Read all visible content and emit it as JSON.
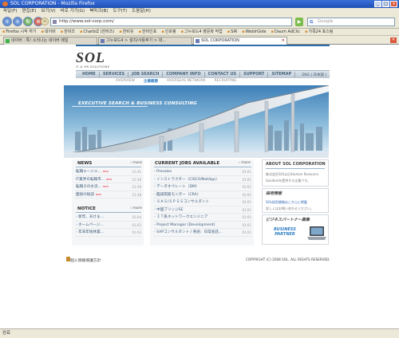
{
  "window": {
    "title": "SOL CORPORATION - Mozilla Firefox",
    "buttons": [
      "_",
      "□",
      "×"
    ]
  },
  "menu": [
    "파일(F)",
    "편집(E)",
    "보기(V)",
    "바로 가기(G)",
    "북마크(B)",
    "도구(T)",
    "도움말(H)"
  ],
  "address": {
    "url": "http://www.sol-corp.com/",
    "search_placeholder": "Google"
  },
  "bookmarks": [
    "Firefox 시작 하기",
    "네이버",
    "한비즈",
    "CharbiZ (한비즈)",
    "한비웃",
    "한비인포",
    "인포펑",
    "그누보드4 영문화 작업",
    "SIR",
    "WebIrGide",
    "Daum AdClic",
    "가족24 포스팅"
  ],
  "tabs": [
    {
      "label": "네이버 : 톡! 소리나는 네이버 메일"
    },
    {
      "label": "그누보드4 > 설치/사용후기 > 대..."
    },
    {
      "label": "SOL CORPORATION"
    }
  ],
  "site": {
    "logo": "SOL",
    "logo_sub": "IT & HR SOLUTIONS",
    "gnb": [
      "HOME",
      "SERVICES",
      "JOB SEARCH",
      "COMPANY INFO",
      "CONTACT US",
      "SUPPORT",
      "SITEMAP"
    ],
    "lang": "ENG | 日本語 |",
    "subnav": [
      "OVERVIEW",
      "企業概要",
      "OVERSEAS NETWORK",
      "RECRUITING"
    ],
    "hero_text": "EXECUTIVE SEARCH & BUSINESS CONSULTING",
    "news": {
      "title": "NEWS",
      "more": "› more",
      "items": [
        {
          "t": "転職エージェ...",
          "d": "21:41",
          "new": "NEW"
        },
        {
          "t": "IT業界の転職市...",
          "d": "21:39",
          "new": "NEW"
        },
        {
          "t": "転職その水流...",
          "d": "21:39",
          "new": "NEW"
        },
        {
          "t": "面接の秘訣",
          "d": "21:38",
          "new": "NEW"
        }
      ]
    },
    "notice": {
      "title": "NOTICE",
      "more": "› more",
      "items": [
        {
          "t": "- 新年、あけま...",
          "d": "01:04"
        },
        {
          "t": "- ホームページ...",
          "d": "01:03"
        },
        {
          "t": "- 年末年始休業...",
          "d": "01:03"
        }
      ]
    },
    "jobs": {
      "title": "CURRENT JOBS AVAILABLE",
      "more": "› more",
      "items": [
        {
          "t": "- Presales",
          "d": "01:01"
        },
        {
          "t": "- インストラクター（CISCO/NetApp）",
          "d": "01:01"
        },
        {
          "t": "- データオペレート（DM）",
          "d": "01:01"
        },
        {
          "t": "- 臨床開発モニター（CRA）",
          "d": "01:01"
        },
        {
          "t": "- ＳＡＳ/ＳＰＳＳコンサルタント",
          "d": "01:01"
        },
        {
          "t": "- 中国ブリッジSE",
          "d": "01:01"
        },
        {
          "t": "- ＩＴ系ネットワークエンジニア",
          "d": "01:01"
        },
        {
          "t": "- Project Manager (Development)",
          "d": "01:01"
        },
        {
          "t": "- SAPコンサルタント / 英語：日常会話...",
          "d": "01:01"
        }
      ]
    },
    "about": {
      "title": "ABOUT SOL CORPORATION",
      "lines": [
        "株式会社SOLは日Human Resource",
        "Solutionを提供する企業です。"
      ]
    },
    "recruit": {
      "title": "採用情報",
      "lines": [
        "SOL採用情報はこちらに掲載",
        "詳しくはお問い合わせください。"
      ]
    },
    "partner": {
      "title": "ビジネスパートナー募集",
      "badge_1": "BUSINESS",
      "badge_2": "PARTNER"
    },
    "footer": {
      "privacy": "個人情報保護方針",
      "copyright": "COPYRIGHT (C) 2008 SOL. ALL RIGHTS RESERVED."
    }
  },
  "status": "완료",
  "colors": {
    "accent": "#2f6da8",
    "titlebar": "#2a5cc4",
    "hero_sky": "#6ea3cc"
  }
}
